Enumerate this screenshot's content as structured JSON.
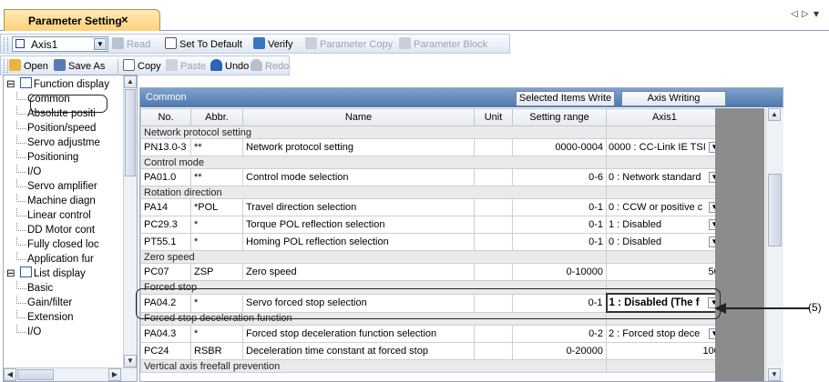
{
  "tab": {
    "title": "Parameter Setting",
    "close": "×"
  },
  "nav_arrows": {
    "left": "◁",
    "right": "▷",
    "menu": "▾"
  },
  "toolbar1": {
    "axis_value": "Axis1",
    "read": "Read",
    "set_default": "Set To Default",
    "verify": "Verify",
    "param_copy": "Parameter Copy",
    "param_block": "Parameter Block"
  },
  "toolbar2": {
    "open": "Open",
    "save_as": "Save As",
    "copy": "Copy",
    "paste": "Paste",
    "undo": "Undo",
    "redo": "Redo"
  },
  "tree": {
    "function_display": "Function display",
    "items_fn": [
      "Common",
      "Absolute positi",
      "Position/speed",
      "Servo adjustme",
      "Positioning",
      "I/O",
      "Servo amplifier",
      "Machine diagn",
      "Linear control",
      "DD Motor cont",
      "Fully closed loc",
      "Application fur"
    ],
    "list_display": "List display",
    "items_list": [
      "Basic",
      "Gain/filter",
      "Extension",
      "I/O"
    ],
    "expand_symbol": "⊟"
  },
  "panel": {
    "title": "Common",
    "selected_items_write": "Selected Items Write",
    "axis_writing": "Axis Writing"
  },
  "columns": [
    "No.",
    "Abbr.",
    "Name",
    "Unit",
    "Setting range",
    "Axis1"
  ],
  "groups": [
    {
      "label": "Network protocol setting",
      "rows": [
        {
          "no": "PN13.0-3",
          "abbr": "**",
          "name": "Network protocol setting",
          "unit": "",
          "range": "0000-0004",
          "value": "0000 : CC-Link IE TSI",
          "dropdown": true
        }
      ]
    },
    {
      "label": "Control mode",
      "rows": [
        {
          "no": "PA01.0",
          "abbr": "**",
          "name": "Control mode selection",
          "unit": "",
          "range": "0-6",
          "value": "0 : Network standard",
          "dropdown": true
        }
      ]
    },
    {
      "label": "Rotation direction",
      "rows": [
        {
          "no": "PA14",
          "abbr": "*POL",
          "name": "Travel direction selection",
          "unit": "",
          "range": "0-1",
          "value": "0 : CCW or positive c",
          "dropdown": true
        },
        {
          "no": "PC29.3",
          "abbr": "*",
          "name": "Torque POL reflection selection",
          "unit": "",
          "range": "0-1",
          "value": "1 : Disabled",
          "dropdown": true
        },
        {
          "no": "PT55.1",
          "abbr": "*",
          "name": "Homing POL reflection selection",
          "unit": "",
          "range": "0-1",
          "value": "0 : Disabled",
          "dropdown": true
        }
      ]
    },
    {
      "label": "Zero speed",
      "rows": [
        {
          "no": "PC07",
          "abbr": "ZSP",
          "name": "Zero speed",
          "unit": "",
          "range": "0-10000",
          "value": "50",
          "dropdown": false
        }
      ]
    },
    {
      "label": "Forced stop",
      "rows": [
        {
          "no": "PA04.2",
          "abbr": "*",
          "name": "Servo forced stop selection",
          "unit": "",
          "range": "0-1",
          "value": "1 : Disabled (The f",
          "dropdown": true,
          "bold": true
        }
      ]
    },
    {
      "label": "Forced stop deceleration function",
      "rows": [
        {
          "no": "PA04.3",
          "abbr": "*",
          "name": "Forced stop deceleration function selection",
          "unit": "",
          "range": "0-2",
          "value": "2 : Forced stop dece",
          "dropdown": true
        },
        {
          "no": "PC24",
          "abbr": "RSBR",
          "name": "Deceleration time constant at forced stop",
          "unit": "",
          "range": "0-20000",
          "value": "100",
          "dropdown": false
        }
      ]
    },
    {
      "label": "Vertical axis freefall prevention",
      "rows": []
    }
  ],
  "annotation": {
    "label": "(5)"
  }
}
